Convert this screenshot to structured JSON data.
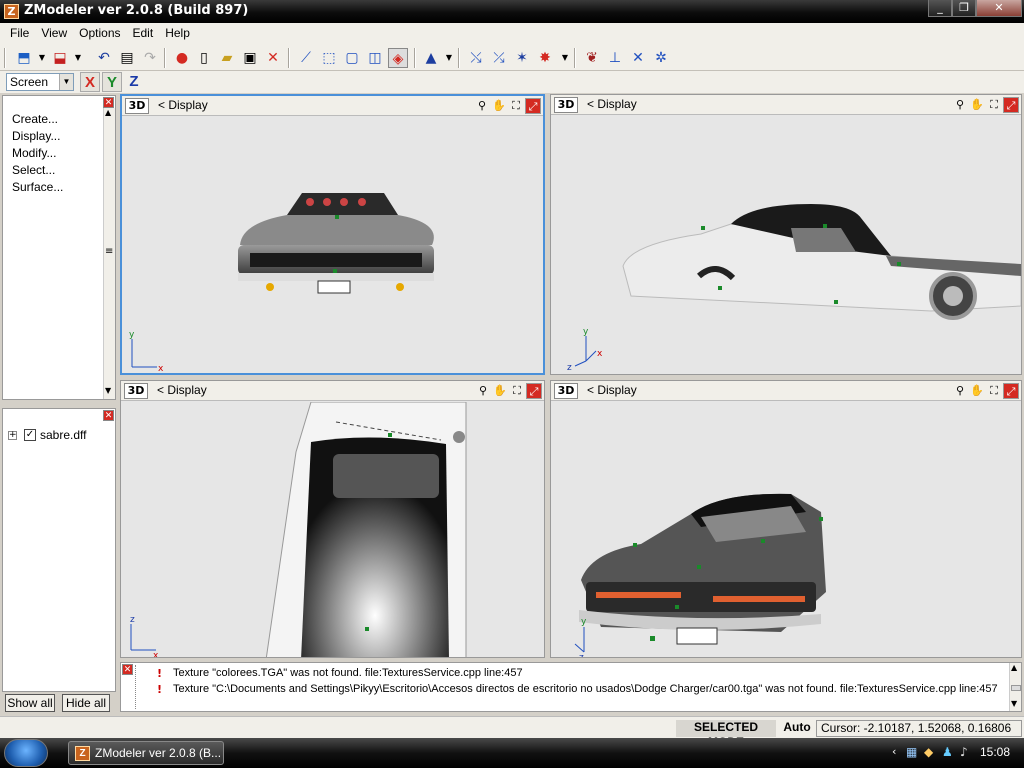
{
  "window": {
    "title": "ZModeler ver 2.0.8 (Build 897)",
    "app_icon": "Z",
    "minimize": "_",
    "maximize": "❐",
    "close": "✕"
  },
  "menubar": [
    "File",
    "View",
    "Options",
    "Edit",
    "Help"
  ],
  "axis_bar": {
    "coordinate_system": "Screen",
    "x_label": "X",
    "y_label": "Y",
    "z_label": "Z",
    "colors": {
      "x": "#d42a22",
      "y": "#1a8a2a",
      "z": "#1a3aa8"
    }
  },
  "command_panel": {
    "items": [
      "Create...",
      "Display...",
      "Modify...",
      "Select...",
      "Surface..."
    ]
  },
  "scene_tree": {
    "root": {
      "expander": "+",
      "checked": "✓",
      "label": "sabre.dff"
    }
  },
  "buttons": {
    "show_all": "Show all",
    "hide_all": "Hide all"
  },
  "viewports": [
    {
      "mode": "3D",
      "label": "<  Display",
      "active": true,
      "axis_x": "x",
      "axis_y": "y"
    },
    {
      "mode": "3D",
      "label": "<  Display",
      "active": false,
      "axis_x": "x",
      "axis_y": "y",
      "axis_z": "z"
    },
    {
      "mode": "3D",
      "label": "<  Display",
      "active": false,
      "axis_x": "x",
      "axis_y": "z"
    },
    {
      "mode": "3D",
      "label": "<  Display",
      "active": false,
      "axis_x": "",
      "axis_y": "y",
      "axis_z": "z"
    }
  ],
  "log": [
    "Texture \"colorees.TGA\" was not found. file:TexturesService.cpp line:457",
    "Texture \"C:\\Documents and Settings\\Pikyy\\Escritorio\\Accesos directos de escritorio no usados\\Dodge Charger/car00.tga\" was not found. file:TexturesService.cpp line:457"
  ],
  "log_marker": "!",
  "status": {
    "mode": "SELECTED MODE",
    "auto": "Auto",
    "cursor": "Cursor: -2.10187, 1.52068, 0.16806"
  },
  "taskbar": {
    "task_label": "ZModeler ver 2.0.8 (B...",
    "clock": "15:08"
  }
}
